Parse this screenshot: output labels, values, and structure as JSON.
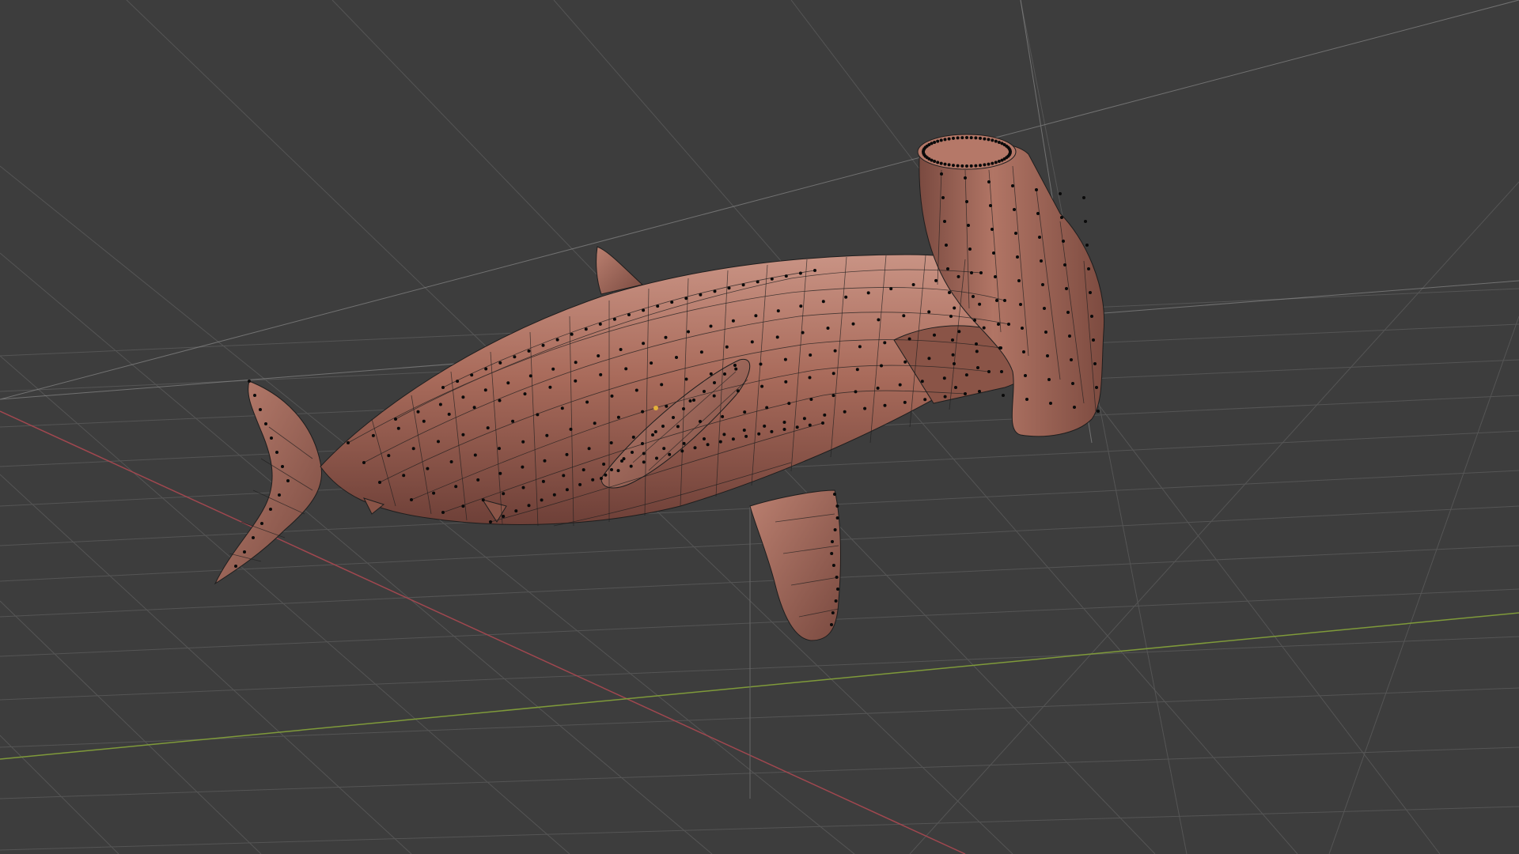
{
  "viewport": {
    "editor": "3d-viewport",
    "mode": "edit-mode",
    "object_name": "",
    "colors": {
      "background": "#3d3d3d",
      "grid": "#5a5a5a",
      "grid_light": "#7a7a7a",
      "x_axis": "#a0474f",
      "y_axis": "#7f9a3a",
      "mesh_fill": "#a86a5a",
      "mesh_shadow": "#6e3f35",
      "mesh_highlight": "#c99384",
      "wire": "#1e1e1e",
      "vertex": "#0a0a0a",
      "origin": "#e3b23a"
    }
  }
}
